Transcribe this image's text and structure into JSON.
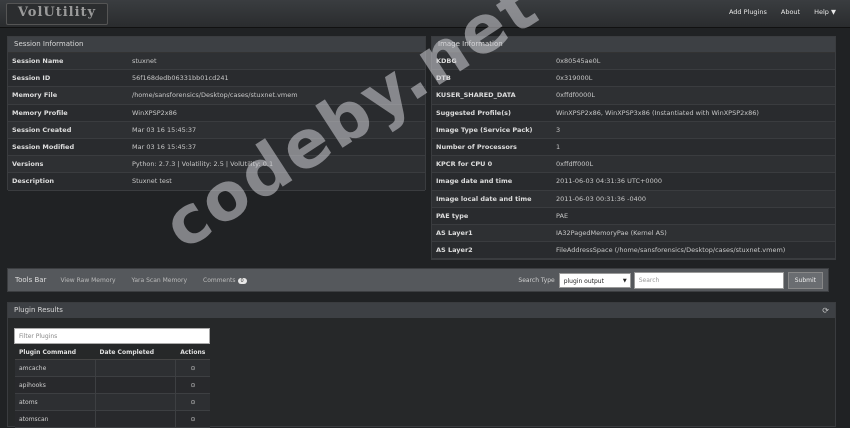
{
  "app": {
    "brand": "VolUtility"
  },
  "nav": {
    "items": [
      "Add Plugins",
      "About",
      "Help"
    ]
  },
  "session": {
    "title": "Session Information",
    "rows": [
      {
        "k": "Session Name",
        "v": "stuxnet"
      },
      {
        "k": "Session ID",
        "v": "56f168dedb06331bb01cd241"
      },
      {
        "k": "Memory File",
        "v": "/home/sansforensics/Desktop/cases/stuxnet.vmem"
      },
      {
        "k": "Memory Profile",
        "v": "WinXPSP2x86"
      },
      {
        "k": "Session Created",
        "v": "Mar 03 16 15:45:37"
      },
      {
        "k": "Session Modified",
        "v": "Mar 03 16 15:45:37"
      },
      {
        "k": "Versions",
        "v": "Python: 2.7.3 | Volatility: 2.5 | VolUtility: 0.1"
      },
      {
        "k": "Description",
        "v": "Stuxnet test"
      }
    ]
  },
  "image": {
    "title": "Image Information",
    "rows": [
      {
        "k": "KDBG",
        "v": "0x80545ae0L"
      },
      {
        "k": "DTB",
        "v": "0x319000L"
      },
      {
        "k": "KUSER_SHARED_DATA",
        "v": "0xffdf0000L"
      },
      {
        "k": "Suggested Profile(s)",
        "v": "WinXPSP2x86, WinXPSP3x86 (Instantiated with WinXPSP2x86)"
      },
      {
        "k": "Image Type (Service Pack)",
        "v": "3"
      },
      {
        "k": "Number of Processors",
        "v": "1"
      },
      {
        "k": "KPCR for CPU 0",
        "v": "0xffdff000L"
      },
      {
        "k": "Image date and time",
        "v": "2011-06-03 04:31:36 UTC+0000"
      },
      {
        "k": "Image local date and time",
        "v": "2011-06-03 00:31:36 -0400"
      },
      {
        "k": "PAE type",
        "v": "PAE"
      },
      {
        "k": "AS Layer1",
        "v": "IA32PagedMemoryPae (Kernel AS)"
      },
      {
        "k": "AS Layer2",
        "v": "FileAddressSpace (/home/sansforensics/Desktop/cases/stuxnet.vmem)"
      }
    ]
  },
  "tools": {
    "title": "Tools Bar",
    "buttons": [
      "View Raw Memory",
      "Yara Scan Memory",
      "Comments"
    ],
    "comments_count": "0",
    "search_label": "Search Type",
    "search_type": "plugin output",
    "search_placeholder": "Search",
    "submit": "Submit"
  },
  "plugins": {
    "title": "Plugin Results",
    "filter_placeholder": "Filter Plugins",
    "columns": [
      "Plugin Command",
      "Date Completed",
      "Actions"
    ],
    "rows": [
      "amcache",
      "apihooks",
      "atoms",
      "atomscan"
    ]
  },
  "watermark": "codeby.net"
}
